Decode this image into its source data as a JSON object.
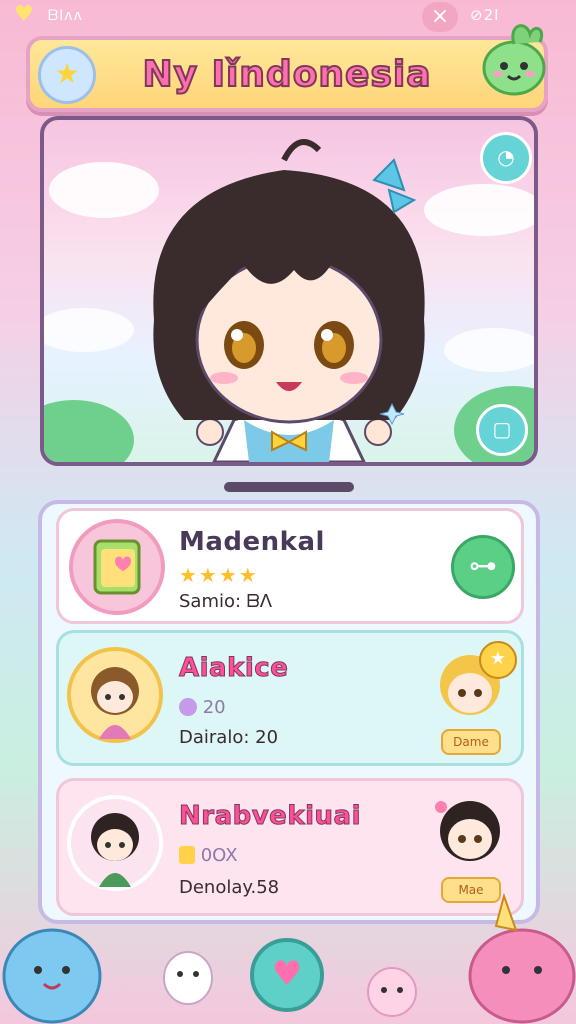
{
  "status_bar": {
    "left_text": "ᗷIᴧᴧ",
    "right_text": "⊘2I",
    "close_icon": "×"
  },
  "header": {
    "title": "Ny Iǐndonesia"
  },
  "list": {
    "items": [
      {
        "name": "Madenkal",
        "rating": "★★★★",
        "sub_text": "Samio: ᗷΛ",
        "action_icon": "bone-icon"
      },
      {
        "name": "Aiakice",
        "stat_value": "20",
        "sub_text": "Dairalo: 20",
        "tag_label": "Dame"
      },
      {
        "name": "Nrabvekiuai",
        "stat_value": "0OX",
        "sub_text": "Denolay.58",
        "tag_label": "Mae"
      }
    ]
  },
  "colors": {
    "accent_pink": "#ff6fae",
    "title_bar": "#ffd579",
    "teal_button": "#5fd0c8",
    "green_button": "#5ccf86"
  }
}
